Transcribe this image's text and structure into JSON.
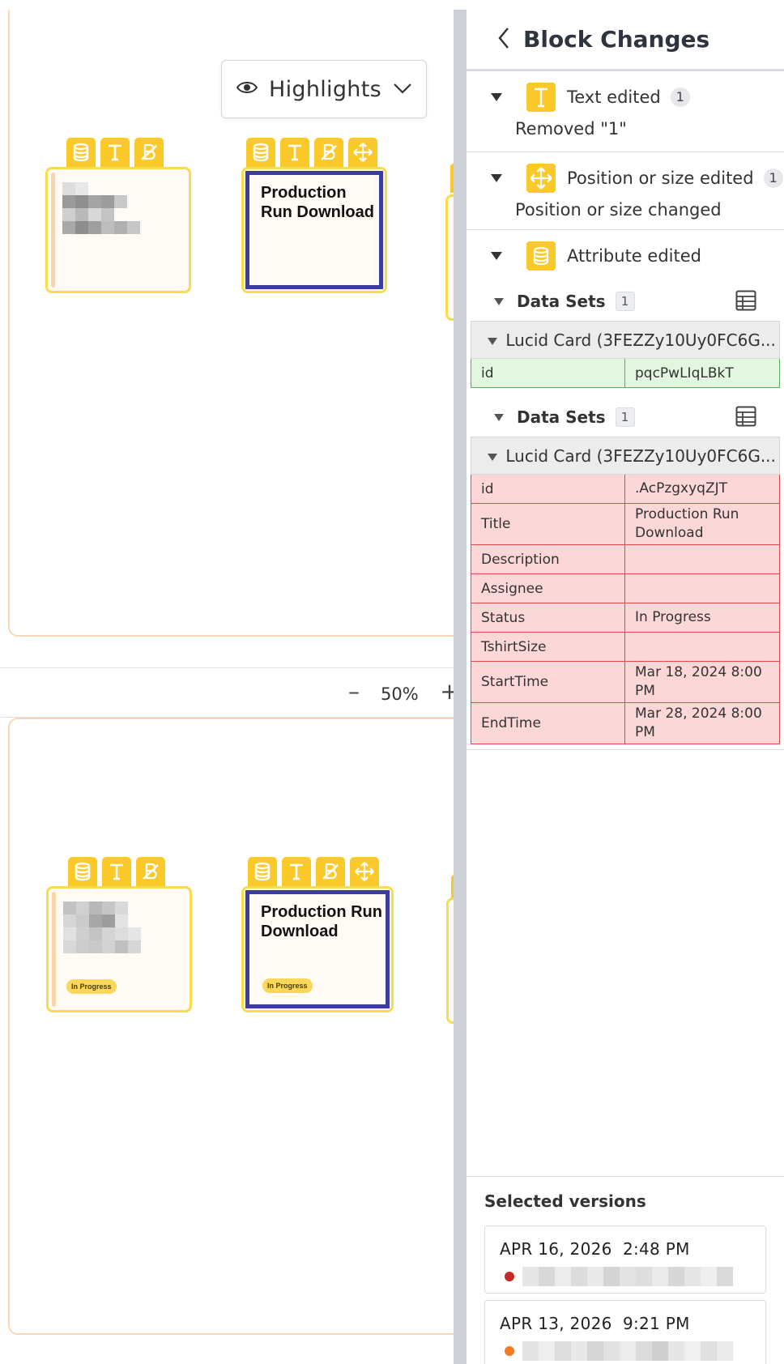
{
  "highlights": {
    "label": "Highlights"
  },
  "canvas": {
    "card_title": "Production Run Download",
    "status": "In Progress",
    "zoom": {
      "minus": "–",
      "value": "50%",
      "plus": "+"
    }
  },
  "panel": {
    "title": "Block Changes",
    "sections": {
      "text": {
        "label": "Text edited",
        "count": "1",
        "detail": "Removed \"1\""
      },
      "position": {
        "label": "Position or size edited",
        "count": "1",
        "detail": "Position or size changed"
      },
      "attribute": {
        "label": "Attribute edited"
      }
    },
    "added": {
      "label": "Data Sets",
      "count": "1",
      "card": "Lucid Card (3FEZZy10Uy0FC6G...",
      "rows": [
        {
          "key": "id",
          "value": "pqcPwLIqLBkT"
        }
      ]
    },
    "removed": {
      "label": "Data Sets",
      "count": "1",
      "card": "Lucid Card (3FEZZy10Uy0FC6G...",
      "rows": [
        {
          "key": "id",
          "value": ".AcPzgxyqZJT"
        },
        {
          "key": "Title",
          "value": "Production Run Download"
        },
        {
          "key": "Description",
          "value": ""
        },
        {
          "key": "Assignee",
          "value": ""
        },
        {
          "key": "Status",
          "value": "In Progress"
        },
        {
          "key": "TshirtSize",
          "value": ""
        },
        {
          "key": "StartTime",
          "value": "Mar 18, 2024 8:00 PM"
        },
        {
          "key": "EndTime",
          "value": "Mar 28, 2024 8:00 PM"
        }
      ]
    },
    "versions": {
      "title": "Selected versions",
      "items": [
        {
          "date": "APR 16, 2026  2:48 PM",
          "dot_color": "#c62828"
        },
        {
          "date": "APR 13, 2026  9:21 PM",
          "dot_color": "#f07b22"
        }
      ]
    }
  },
  "colors": {
    "badge_yellow": "#fbc92a",
    "card_border": "#f7dc52",
    "selection_blue": "#3d3aa0",
    "added_green": "#e2f6e0",
    "removed_red": "#fbd7d7"
  }
}
